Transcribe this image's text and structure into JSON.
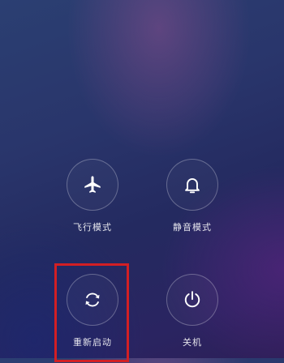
{
  "power_menu": {
    "options": [
      {
        "id": "airplane",
        "label": "飞行模式",
        "icon": "airplane-icon"
      },
      {
        "id": "silent",
        "label": "静音模式",
        "icon": "bell-icon"
      },
      {
        "id": "reboot",
        "label": "重新启动",
        "icon": "restart-icon"
      },
      {
        "id": "shutdown",
        "label": "关机",
        "icon": "power-icon"
      }
    ]
  },
  "annotation": {
    "highlight_color": "#d21f24",
    "highlighted_option": "reboot"
  }
}
